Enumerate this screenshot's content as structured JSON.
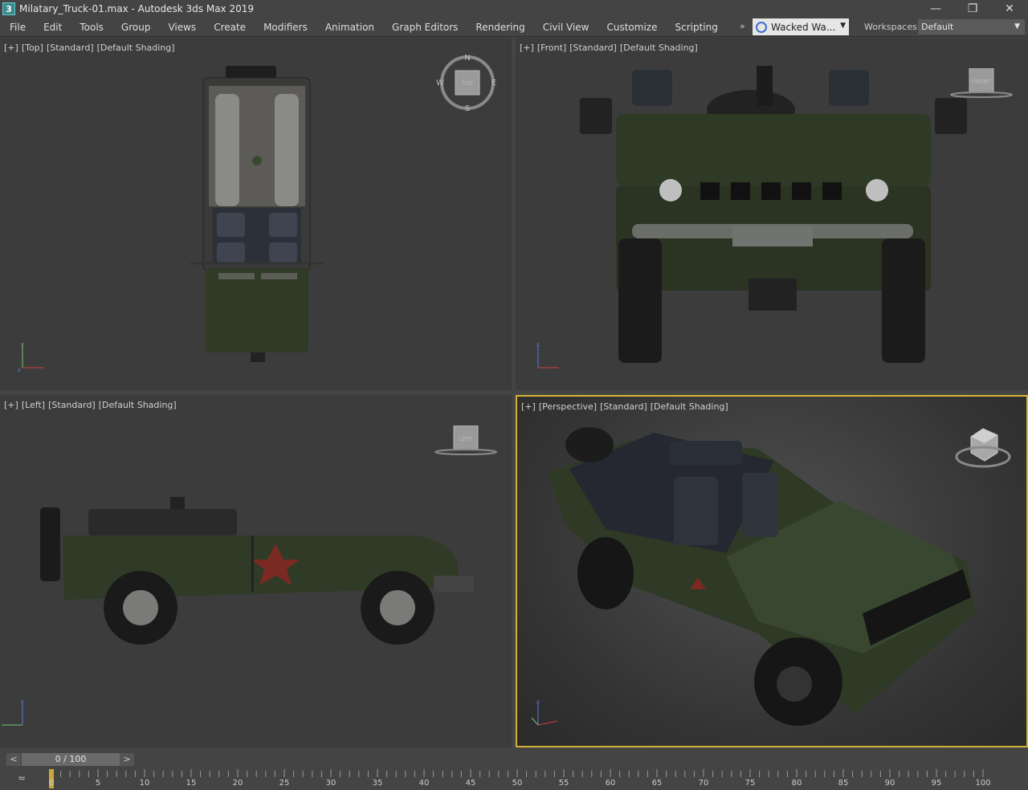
{
  "window": {
    "title": "Milatary_Truck-01.max - Autodesk 3ds Max 2019",
    "app_icon": "3",
    "buttons": [
      "—",
      "❐",
      "✕"
    ]
  },
  "menu": {
    "items": [
      "File",
      "Edit",
      "Tools",
      "Group",
      "Views",
      "Create",
      "Modifiers",
      "Animation",
      "Graph Editors",
      "Rendering",
      "Civil View",
      "Customize",
      "Scripting"
    ],
    "more": "»",
    "user": "Wacked Wa...",
    "workspaces_label": "Workspaces:",
    "workspace_value": "Default"
  },
  "viewports": {
    "top": {
      "labels": [
        "[+]",
        "[Top]",
        "[Standard]",
        "[Default Shading]"
      ],
      "compass": {
        "n": "N",
        "s": "S",
        "e": "E",
        "w": "W",
        "face": "TOP"
      }
    },
    "front": {
      "labels": [
        "[+]",
        "[Front]",
        "[Standard]",
        "[Default Shading]"
      ],
      "cube_face": "FRONT"
    },
    "left": {
      "labels": [
        "[+]",
        "[Left]",
        "[Standard]",
        "[Default Shading]"
      ],
      "cube_face": "LEFT"
    },
    "perspective": {
      "labels": [
        "[+]",
        "[Perspective]",
        "[Standard]",
        "[Default Shading]"
      ]
    }
  },
  "timeline": {
    "prev": "<",
    "next": ">",
    "frame_display": "0 / 100",
    "ticks": [
      "0",
      "5",
      "10",
      "15",
      "20",
      "25",
      "30",
      "35",
      "40",
      "45",
      "50",
      "55",
      "60",
      "65",
      "70",
      "75",
      "80",
      "85",
      "90",
      "95",
      "100"
    ],
    "current_frame": 0,
    "total_frames": 100
  },
  "colors": {
    "active_viewport_border": "#d6b13a",
    "truck_green": "#2e3a25",
    "star_red": "#8a2a22"
  }
}
